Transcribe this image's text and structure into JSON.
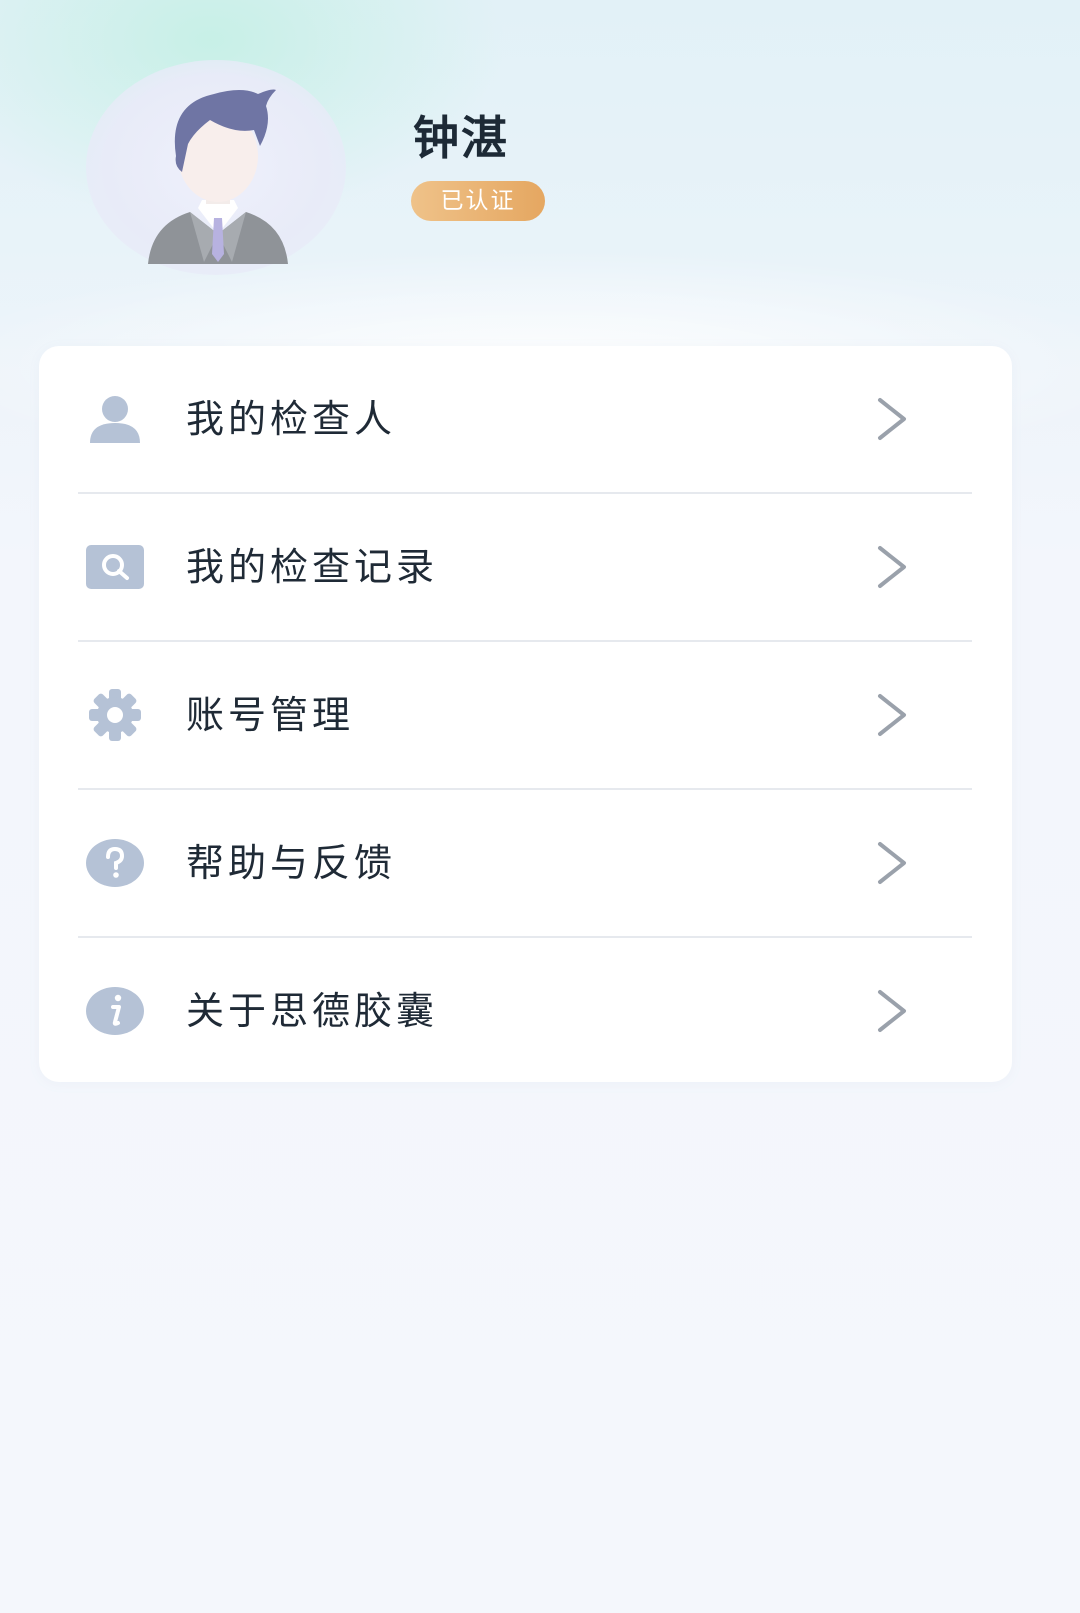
{
  "profile": {
    "name": "钟湛",
    "badge": "已认证",
    "avatar_icon": "user-avatar-icon"
  },
  "menu": {
    "items": [
      {
        "label": "我的检查人",
        "icon": "person-icon"
      },
      {
        "label": "我的检查记录",
        "icon": "search-record-icon"
      },
      {
        "label": "账号管理",
        "icon": "gear-icon"
      },
      {
        "label": "帮助与反馈",
        "icon": "help-icon"
      },
      {
        "label": "关于思德胶囊",
        "icon": "info-icon"
      }
    ]
  },
  "colors": {
    "icon": "#b5c2d6",
    "badge_start": "#efc289",
    "badge_end": "#e5a761",
    "text": "#1f2a36",
    "chevron": "#9aa1ab"
  }
}
